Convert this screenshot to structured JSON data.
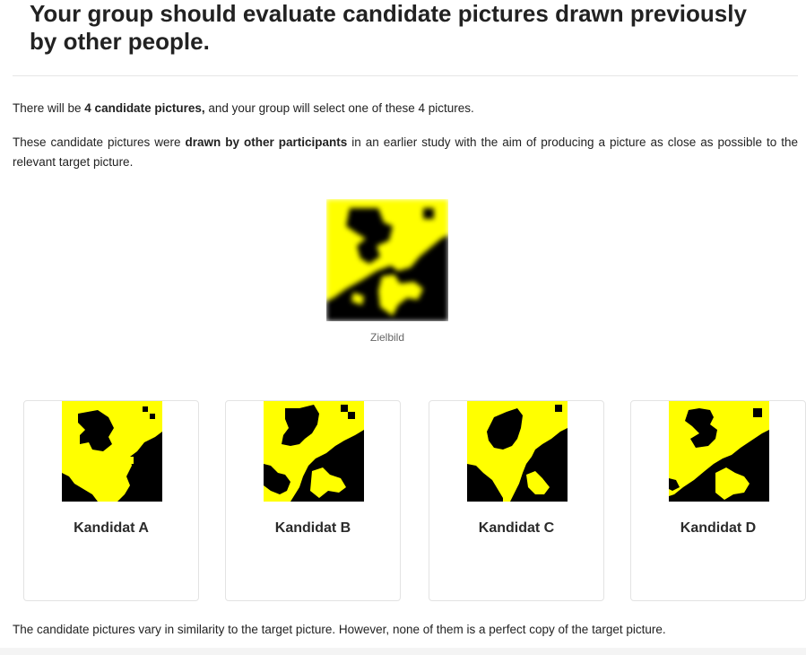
{
  "heading": "Your group should evaluate candidate pictures drawn previously by other people.",
  "intro": {
    "p1_a": "There will be ",
    "p1_bold": "4 candidate pictures,",
    "p1_b": " and your group will select one of these 4 pictures.",
    "p2_a": "These candidate pictures were ",
    "p2_bold": "drawn by other participants",
    "p2_b": " in an earlier study with the aim of producing a picture as close as possible to the relevant target picture."
  },
  "target": {
    "caption": "Zielbild"
  },
  "candidates": [
    {
      "label": "Kandidat A"
    },
    {
      "label": "Kandidat B"
    },
    {
      "label": "Kandidat C"
    },
    {
      "label": "Kandidat D"
    }
  ],
  "footer_text": "The candidate pictures vary in similarity to the target picture. However, none of them is a perfect copy of the target picture.",
  "colors": {
    "yellow": "#ffff00",
    "black": "#000000"
  }
}
